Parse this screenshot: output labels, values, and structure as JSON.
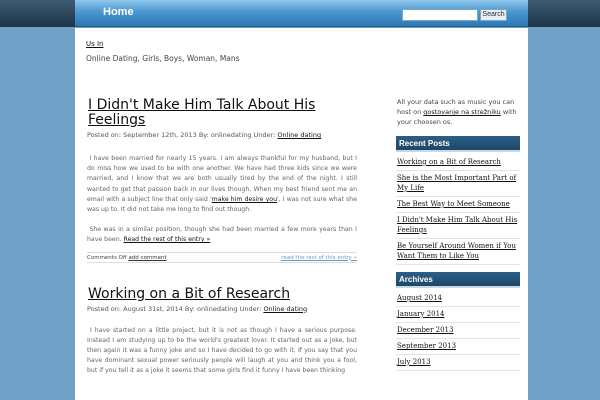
{
  "nav": {
    "home": "Home"
  },
  "search": {
    "placeholder": "",
    "button": "Search"
  },
  "header": {
    "us_link": "Us In",
    "tagline": "Online Dating, Girls, Boys, Woman, Mans"
  },
  "posts": [
    {
      "title_line1": "I Didn't Make Him Talk About His",
      "title_line2": "Feelings",
      "meta_prefix": "Posted on: September 12th, 2013 By: onlinedating Under:",
      "category": "Online dating",
      "para1_before": "I have been married for nearly 15 years. I am always thankful for my husband, but I do miss how we used to be with one another. We have had three kids since we were married, and I know that we are both usually tired by the end of the night. I still wanted to get that passion back in our lives though. When my best friend sent me an email with a subject line that only said '",
      "para1_link": "make him desire you",
      "para1_after": "', I was not sure what she was up to. It did not take me long to find out though.",
      "para2": "She was in a similar position, though she had been married a few more years than I have been.",
      "read_more": "Read the rest of this entry »",
      "comments_prefix": "Comments Off",
      "add_comment": "add comment",
      "read_rest_right": "read the rest of this entry »"
    },
    {
      "title": "Working on a Bit of Research",
      "meta_prefix": "Posted on: August 31st, 2014 By: onlinedating Under:",
      "category": "Online dating",
      "para1": "I have started on a little project, but it is not as though I have a serious purpose. Instead I am studying up to be the world's greatest lover. It started out as a joke, but then again it was a funny joke and so I have decided to go with it. If you say that you have dominant sexual power seriously people will laugh at you and think you a fool, but if you tell it as a joke it seems that some girls find it funny I have been thinking"
    }
  ],
  "sidebar": {
    "intro_before": "All your data such as music you can host on",
    "intro_link": "gostovanje na strežniku",
    "intro_after": "with your choosen os.",
    "recent_title": "Recent Posts",
    "recent": [
      "Working on a Bit of Research",
      "She is the Most Important Part of My Life",
      "The Best Way to Meet Someone",
      "I Didn't Make Him Talk About His Feelings",
      "Be Yourself Around Women if You Want Them to Like You"
    ],
    "archives_title": "Archives",
    "archives": [
      "August 2014",
      "January 2014",
      "December 2013",
      "September 2013",
      "July 2013"
    ]
  }
}
